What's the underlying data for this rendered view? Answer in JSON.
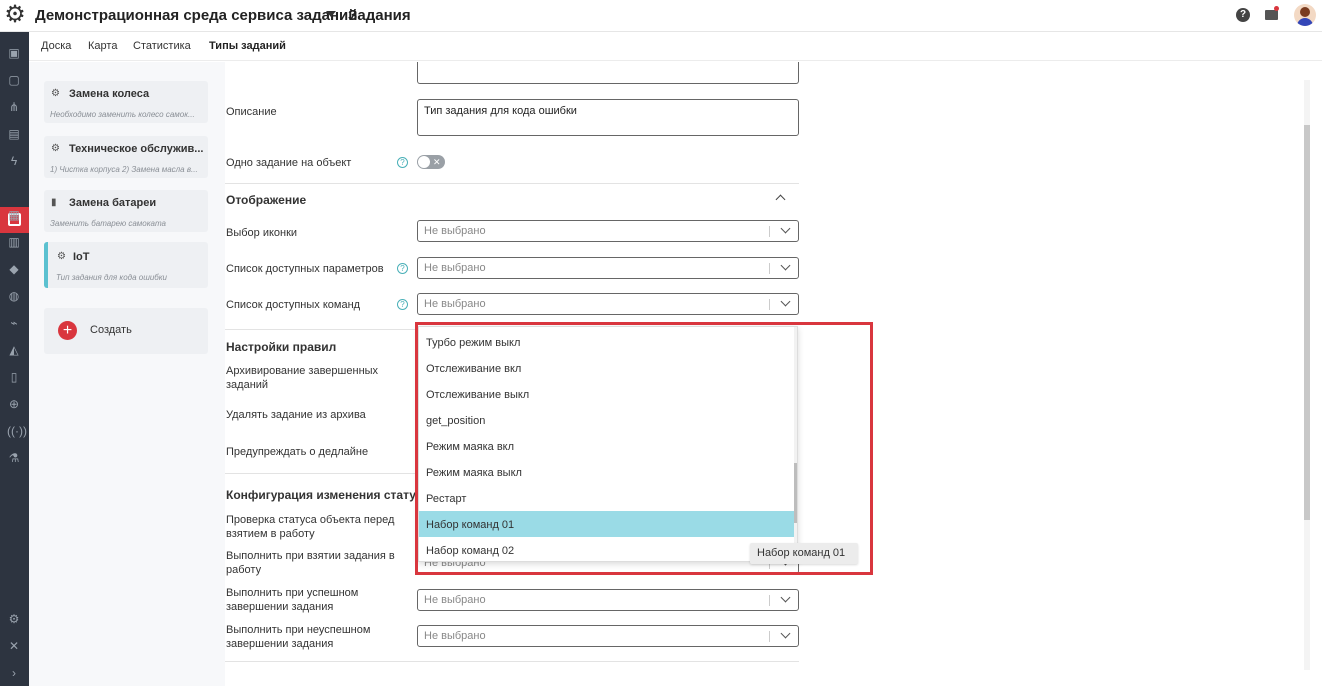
{
  "header": {
    "app_title": "Демонстрационная среда сервиса заданий",
    "section_title": "Задания"
  },
  "tabs": [
    {
      "label": "Доска"
    },
    {
      "label": "Карта"
    },
    {
      "label": "Статистика"
    },
    {
      "label": "Типы заданий"
    }
  ],
  "task_types": [
    {
      "title": "Замена колеса",
      "subtitle": "Необходимо заменить колесо самок..."
    },
    {
      "title": "Техническое обслужив...",
      "subtitle": "1) Чистка корпуса 2) Замена масла в..."
    },
    {
      "title": "Замена батареи",
      "subtitle": "Заменить батарею самоката"
    },
    {
      "title": "IoT",
      "subtitle": "Тип задания для кода ошибки"
    }
  ],
  "create_label": "Создать",
  "form": {
    "description_label": "Описание",
    "description_value": "Тип задания для кода ошибки",
    "one_task_label": "Одно задание на объект",
    "display_section": "Отображение",
    "icon_label": "Выбор иконки",
    "params_label": "Список доступных параметров",
    "commands_label": "Список доступных команд",
    "placeholder": "Не выбрано",
    "rules_section": "Настройки правил",
    "archive_label": "Архивирование завершенных заданий",
    "delete_label": "Удалять задание из архива",
    "deadline_label": "Предупреждать о дедлайне",
    "config_section": "Конфигурация изменения стату",
    "check_status_label": "Проверка статуса объекта перед взятием в работу",
    "on_take_label": "Выполнить при взятии задания в работу",
    "on_success_label": "Выполнить при успешном завершении задания",
    "on_fail_label": "Выполнить при неуспешном завершении задания"
  },
  "dropdown_options": [
    {
      "label": "Турбо режим выкл"
    },
    {
      "label": "Отслеживание вкл"
    },
    {
      "label": "Отслеживание выкл"
    },
    {
      "label": "get_position"
    },
    {
      "label": "Режим маяка вкл"
    },
    {
      "label": "Режим маяка выкл"
    },
    {
      "label": "Рестарт"
    },
    {
      "label": "Набор команд 01"
    },
    {
      "label": "Набор команд 02"
    }
  ],
  "highlighted_option": "Набор команд 01",
  "tooltip": "Набор команд 01",
  "colors": {
    "accent": "#d9363e",
    "highlight": "#9adbe6",
    "sidebar": "#2d3440",
    "selected_border": "#5bc1d0"
  }
}
